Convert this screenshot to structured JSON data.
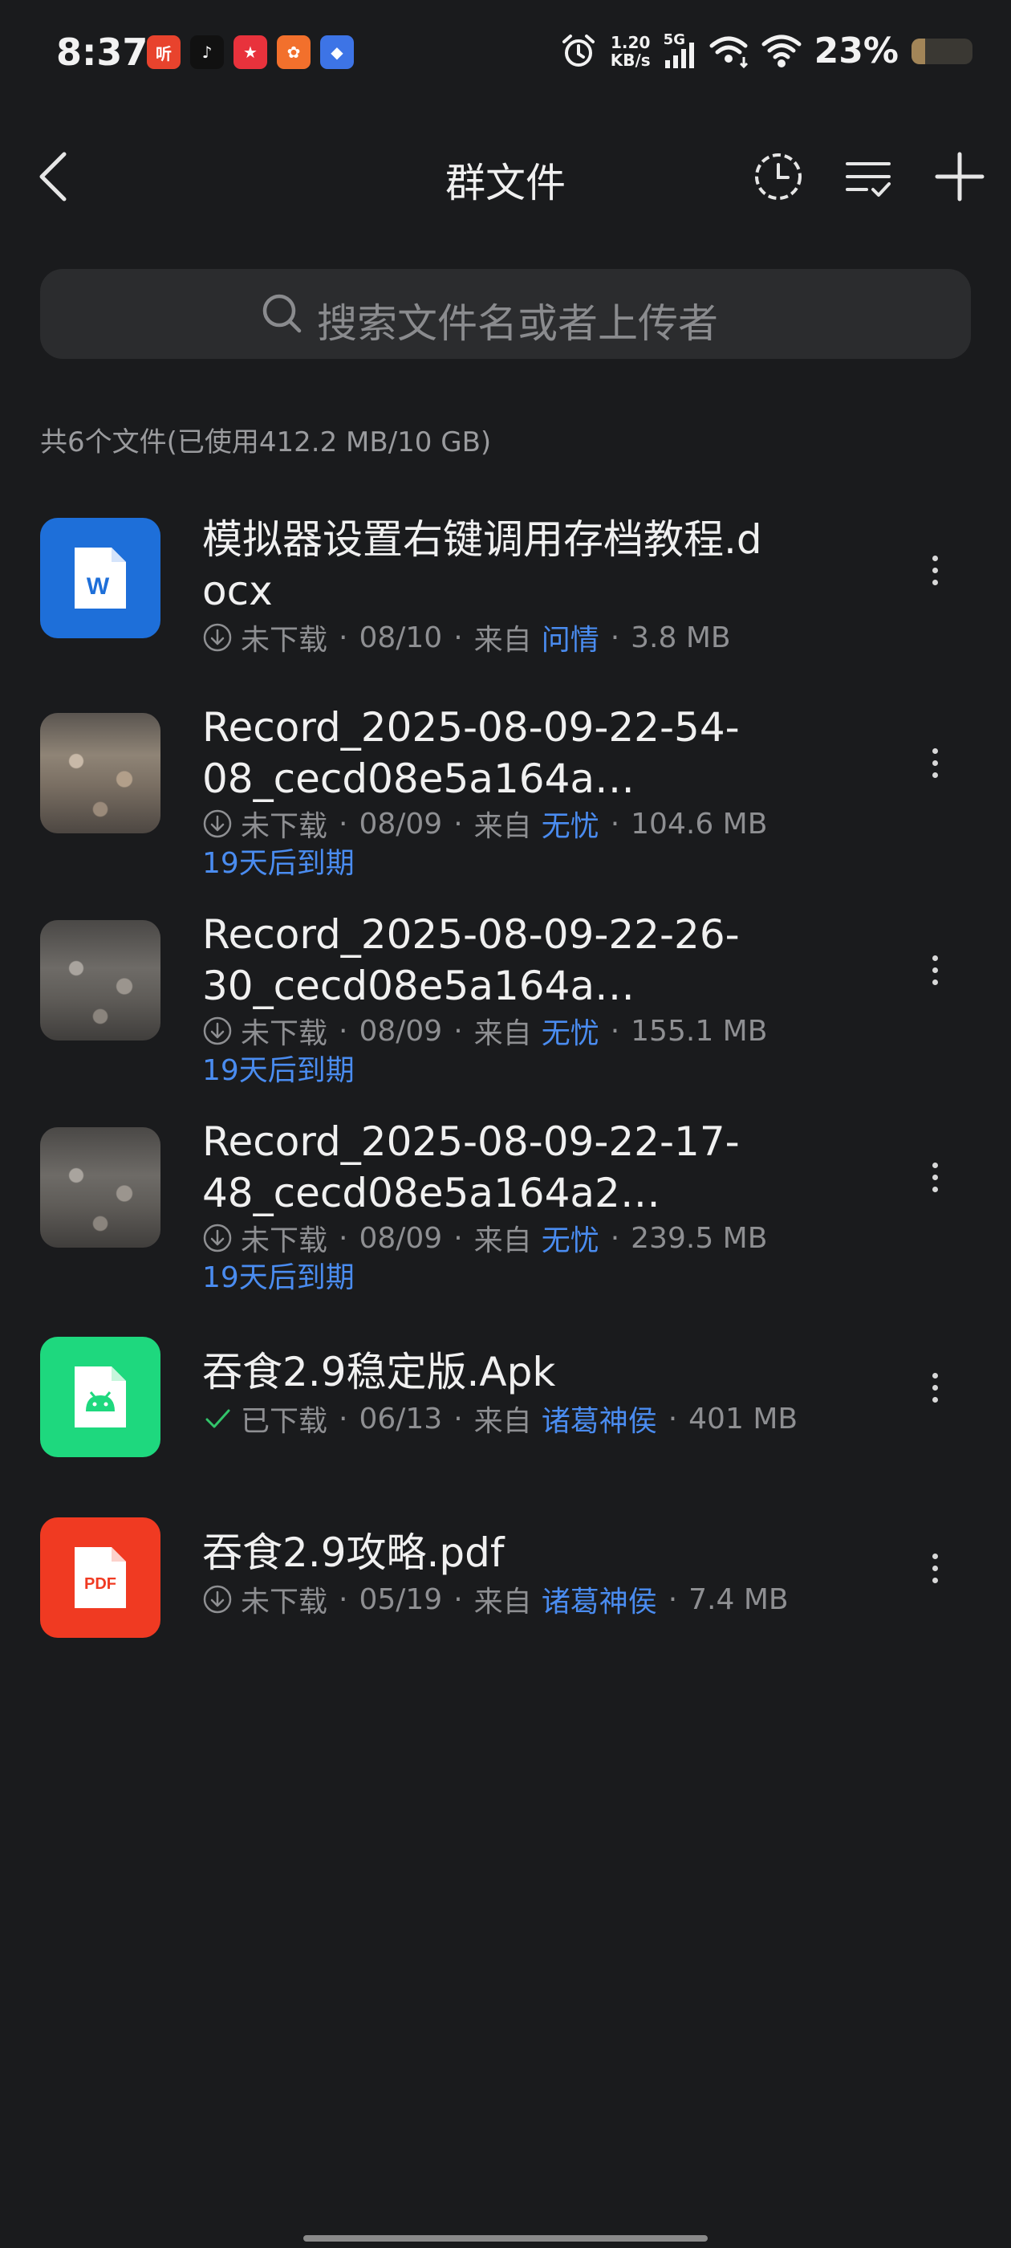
{
  "status_bar": {
    "time": "8:37",
    "app_icons": [
      {
        "name": "ting-app-icon",
        "glyph": "听",
        "color": "#e8432d"
      },
      {
        "name": "music-app-icon",
        "glyph": "♪",
        "color": "#111111"
      },
      {
        "name": "game-app-icon",
        "glyph": "★",
        "color": "#e8323c"
      },
      {
        "name": "orange-app-icon",
        "glyph": "✿",
        "color": "#f2702c"
      },
      {
        "name": "blue-app-icon",
        "glyph": "◆",
        "color": "#3d74e6"
      }
    ],
    "net_speed_value": "1.20",
    "net_speed_unit": "KB/s",
    "network_type": "5G",
    "battery_percent": "23%",
    "battery_level": 0.23
  },
  "header": {
    "title": "群文件"
  },
  "search": {
    "placeholder": "搜索文件名或者上传者"
  },
  "summary": "共6个文件(已使用412.2 MB/10 GB)",
  "files": [
    {
      "name": "模拟器设置右键调用存档教程.docx",
      "icon": "word-icon",
      "status": "未下载",
      "status_icon": "download-icon",
      "date": "08/10",
      "from_label": "来自",
      "uploader": "问情",
      "size": "3.8 MB",
      "expire": ""
    },
    {
      "name": "Record_2025-08-09-22-54-08_cecd08e5a164a…",
      "icon": "video-thumbnail",
      "status": "未下载",
      "status_icon": "download-icon",
      "date": "08/09",
      "from_label": "来自",
      "uploader": "无忧",
      "size": "104.6 MB",
      "expire": "19天后到期"
    },
    {
      "name": "Record_2025-08-09-22-26-30_cecd08e5a164a…",
      "icon": "video-thumbnail",
      "status": "未下载",
      "status_icon": "download-icon",
      "date": "08/09",
      "from_label": "来自",
      "uploader": "无忧",
      "size": "155.1 MB",
      "expire": "19天后到期"
    },
    {
      "name": "Record_2025-08-09-22-17-48_cecd08e5a164a2…",
      "icon": "video-thumbnail",
      "status": "未下载",
      "status_icon": "download-icon",
      "date": "08/09",
      "from_label": "来自",
      "uploader": "无忧",
      "size": "239.5 MB",
      "expire": "19天后到期"
    },
    {
      "name": "吞食2.9稳定版.Apk",
      "icon": "apk-icon",
      "status": "已下载",
      "status_icon": "check-icon",
      "date": "06/13",
      "from_label": "来自",
      "uploader": "诸葛神侯",
      "size": "401 MB",
      "expire": ""
    },
    {
      "name": "吞食2.9攻略.pdf",
      "icon": "pdf-icon",
      "status": "未下载",
      "status_icon": "download-icon",
      "date": "05/19",
      "from_label": "来自",
      "uploader": "诸葛神侯",
      "size": "7.4 MB",
      "expire": ""
    }
  ],
  "icon_labels": {
    "word": "W",
    "pdf": "PDF"
  },
  "colors": {
    "background": "#1a1b1d",
    "accent": "#4a8cf0",
    "word": "#1e6fd9",
    "apk": "#1ed87e",
    "pdf": "#f03a22",
    "downloaded": "#32c46a"
  }
}
